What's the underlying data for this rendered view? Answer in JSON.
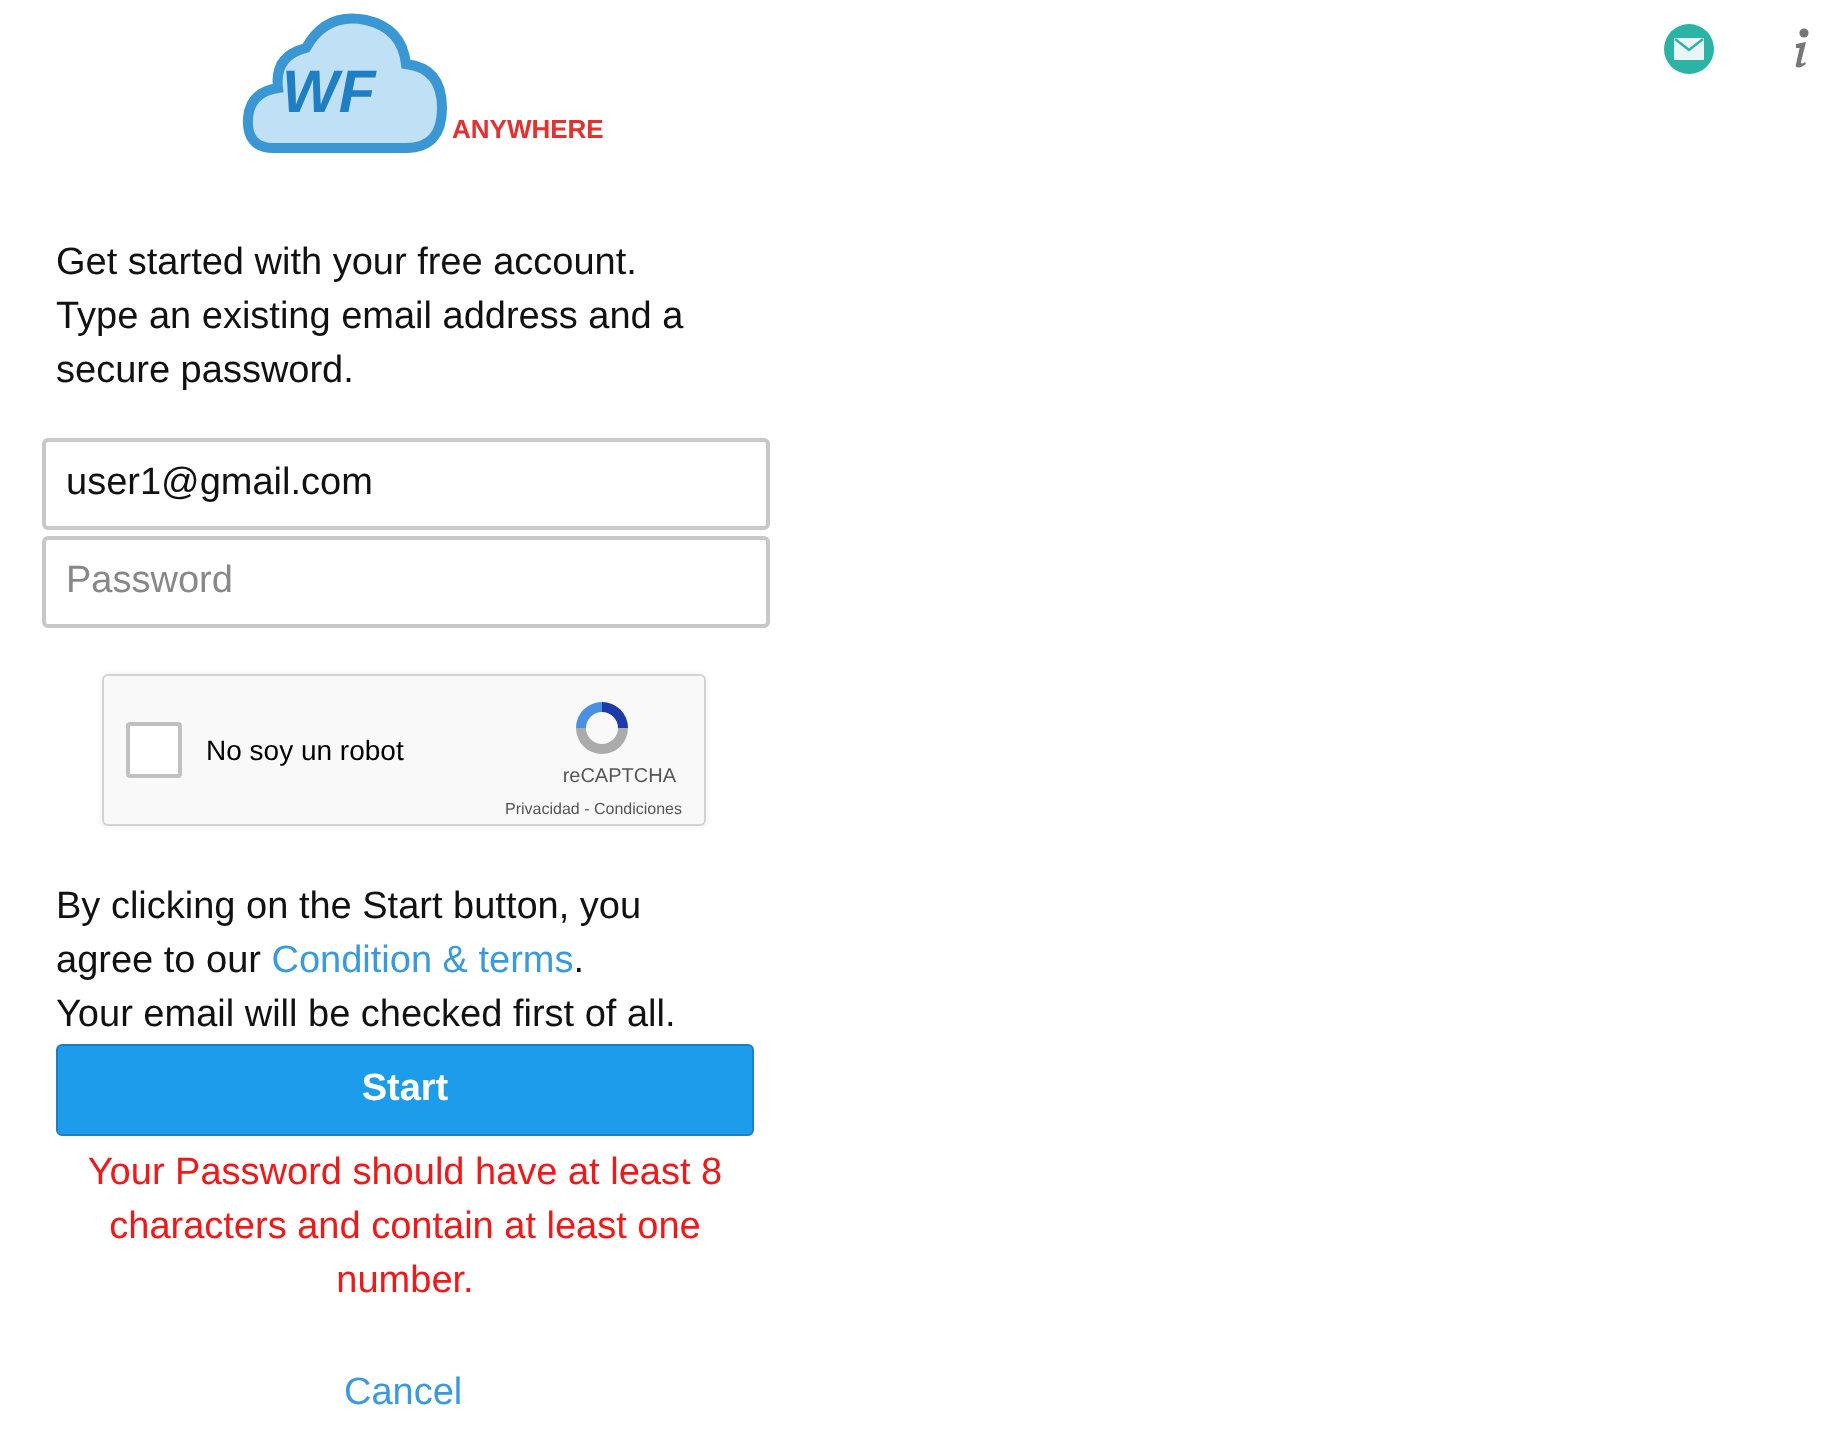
{
  "logo": {
    "mark": "WF",
    "word": "ANYWHERE"
  },
  "intro": [
    "Get started with your free account.",
    "Type an existing email address and a",
    "secure password."
  ],
  "email": {
    "value": "user1@gmail.com"
  },
  "password": {
    "placeholder": "Password"
  },
  "captcha": {
    "label": "No soy un robot",
    "checked": false,
    "brand": "reCAPTCHA",
    "links": "Privacidad - Condiciones"
  },
  "agreement": {
    "line1": "By clicking on the Start button, you",
    "line2_before": "agree to our ",
    "link": "Condition & terms",
    "line2_after": ".",
    "line3": "Your email will be checked first of all."
  },
  "start_button": "Start",
  "error": [
    "Your Password should have at least 8",
    "characters and contain at least one",
    "number."
  ],
  "cancel": "Cancel"
}
